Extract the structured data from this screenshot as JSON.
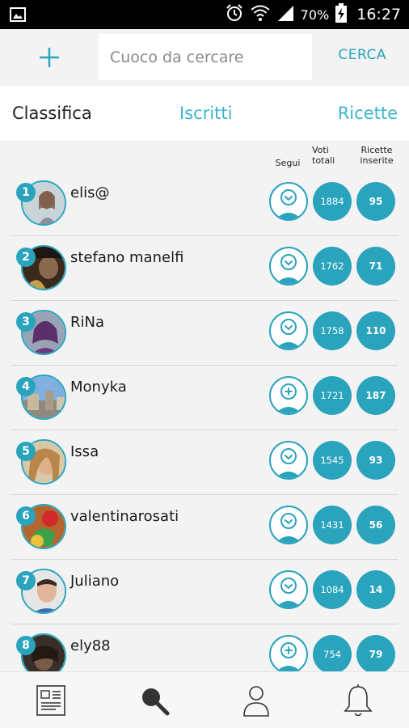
{
  "status_bar": {
    "battery_percent": "70%",
    "time": "16:27",
    "icons": [
      "gallery-icon",
      "alarm-icon",
      "wifi-icon",
      "signal-icon",
      "battery-charging-icon"
    ]
  },
  "search": {
    "add_icon": "plus-icon",
    "placeholder": "Cuoco da cercare",
    "value": "",
    "button_label": "CERCA"
  },
  "tabs": {
    "classifica": "Classifica",
    "iscritti": "Iscritti",
    "ricette": "Ricette",
    "active": "classifica"
  },
  "columns": {
    "segui": "Segui",
    "voti_line1": "Voti",
    "voti_line2": "totali",
    "ricette_line1": "Ricette",
    "ricette_line2": "inserite"
  },
  "ranking": [
    {
      "rank": "1",
      "name": "elis@",
      "followed": true,
      "votes": "1884",
      "recipes": "95"
    },
    {
      "rank": "2",
      "name": "stefano manelfi",
      "followed": true,
      "votes": "1762",
      "recipes": "71"
    },
    {
      "rank": "3",
      "name": "RiNa",
      "followed": true,
      "votes": "1758",
      "recipes": "110"
    },
    {
      "rank": "4",
      "name": "Monyka",
      "followed": false,
      "votes": "1721",
      "recipes": "187"
    },
    {
      "rank": "5",
      "name": "Issa",
      "followed": true,
      "votes": "1545",
      "recipes": "93"
    },
    {
      "rank": "6",
      "name": "valentinarosati",
      "followed": true,
      "votes": "1431",
      "recipes": "56"
    },
    {
      "rank": "7",
      "name": "Juliano",
      "followed": true,
      "votes": "1084",
      "recipes": "14"
    },
    {
      "rank": "8",
      "name": "ely88",
      "followed": false,
      "votes": "754",
      "recipes": "79"
    }
  ],
  "bottom_nav": [
    "news-icon",
    "search-icon",
    "profile-icon",
    "notifications-icon"
  ],
  "colors": {
    "accent": "#2aa3bd",
    "tab_inactive": "#3cb4cf",
    "background": "#f3f3f3",
    "status_bar": "#000000"
  }
}
